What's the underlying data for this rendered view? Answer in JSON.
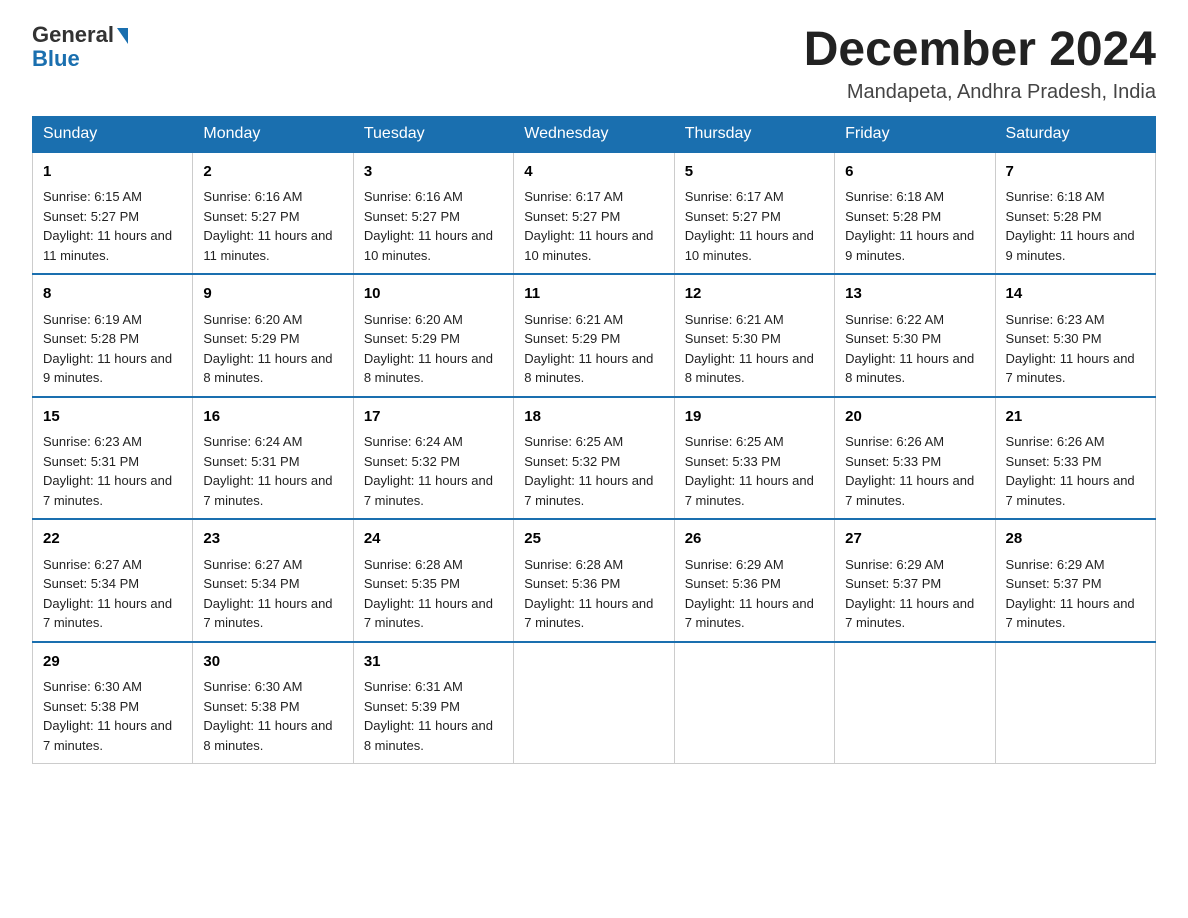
{
  "header": {
    "logo_general": "General",
    "logo_blue": "Blue",
    "title": "December 2024",
    "subtitle": "Mandapeta, Andhra Pradesh, India"
  },
  "columns": [
    "Sunday",
    "Monday",
    "Tuesday",
    "Wednesday",
    "Thursday",
    "Friday",
    "Saturday"
  ],
  "weeks": [
    [
      {
        "day": "1",
        "sunrise": "Sunrise: 6:15 AM",
        "sunset": "Sunset: 5:27 PM",
        "daylight": "Daylight: 11 hours and 11 minutes."
      },
      {
        "day": "2",
        "sunrise": "Sunrise: 6:16 AM",
        "sunset": "Sunset: 5:27 PM",
        "daylight": "Daylight: 11 hours and 11 minutes."
      },
      {
        "day": "3",
        "sunrise": "Sunrise: 6:16 AM",
        "sunset": "Sunset: 5:27 PM",
        "daylight": "Daylight: 11 hours and 10 minutes."
      },
      {
        "day": "4",
        "sunrise": "Sunrise: 6:17 AM",
        "sunset": "Sunset: 5:27 PM",
        "daylight": "Daylight: 11 hours and 10 minutes."
      },
      {
        "day": "5",
        "sunrise": "Sunrise: 6:17 AM",
        "sunset": "Sunset: 5:27 PM",
        "daylight": "Daylight: 11 hours and 10 minutes."
      },
      {
        "day": "6",
        "sunrise": "Sunrise: 6:18 AM",
        "sunset": "Sunset: 5:28 PM",
        "daylight": "Daylight: 11 hours and 9 minutes."
      },
      {
        "day": "7",
        "sunrise": "Sunrise: 6:18 AM",
        "sunset": "Sunset: 5:28 PM",
        "daylight": "Daylight: 11 hours and 9 minutes."
      }
    ],
    [
      {
        "day": "8",
        "sunrise": "Sunrise: 6:19 AM",
        "sunset": "Sunset: 5:28 PM",
        "daylight": "Daylight: 11 hours and 9 minutes."
      },
      {
        "day": "9",
        "sunrise": "Sunrise: 6:20 AM",
        "sunset": "Sunset: 5:29 PM",
        "daylight": "Daylight: 11 hours and 8 minutes."
      },
      {
        "day": "10",
        "sunrise": "Sunrise: 6:20 AM",
        "sunset": "Sunset: 5:29 PM",
        "daylight": "Daylight: 11 hours and 8 minutes."
      },
      {
        "day": "11",
        "sunrise": "Sunrise: 6:21 AM",
        "sunset": "Sunset: 5:29 PM",
        "daylight": "Daylight: 11 hours and 8 minutes."
      },
      {
        "day": "12",
        "sunrise": "Sunrise: 6:21 AM",
        "sunset": "Sunset: 5:30 PM",
        "daylight": "Daylight: 11 hours and 8 minutes."
      },
      {
        "day": "13",
        "sunrise": "Sunrise: 6:22 AM",
        "sunset": "Sunset: 5:30 PM",
        "daylight": "Daylight: 11 hours and 8 minutes."
      },
      {
        "day": "14",
        "sunrise": "Sunrise: 6:23 AM",
        "sunset": "Sunset: 5:30 PM",
        "daylight": "Daylight: 11 hours and 7 minutes."
      }
    ],
    [
      {
        "day": "15",
        "sunrise": "Sunrise: 6:23 AM",
        "sunset": "Sunset: 5:31 PM",
        "daylight": "Daylight: 11 hours and 7 minutes."
      },
      {
        "day": "16",
        "sunrise": "Sunrise: 6:24 AM",
        "sunset": "Sunset: 5:31 PM",
        "daylight": "Daylight: 11 hours and 7 minutes."
      },
      {
        "day": "17",
        "sunrise": "Sunrise: 6:24 AM",
        "sunset": "Sunset: 5:32 PM",
        "daylight": "Daylight: 11 hours and 7 minutes."
      },
      {
        "day": "18",
        "sunrise": "Sunrise: 6:25 AM",
        "sunset": "Sunset: 5:32 PM",
        "daylight": "Daylight: 11 hours and 7 minutes."
      },
      {
        "day": "19",
        "sunrise": "Sunrise: 6:25 AM",
        "sunset": "Sunset: 5:33 PM",
        "daylight": "Daylight: 11 hours and 7 minutes."
      },
      {
        "day": "20",
        "sunrise": "Sunrise: 6:26 AM",
        "sunset": "Sunset: 5:33 PM",
        "daylight": "Daylight: 11 hours and 7 minutes."
      },
      {
        "day": "21",
        "sunrise": "Sunrise: 6:26 AM",
        "sunset": "Sunset: 5:33 PM",
        "daylight": "Daylight: 11 hours and 7 minutes."
      }
    ],
    [
      {
        "day": "22",
        "sunrise": "Sunrise: 6:27 AM",
        "sunset": "Sunset: 5:34 PM",
        "daylight": "Daylight: 11 hours and 7 minutes."
      },
      {
        "day": "23",
        "sunrise": "Sunrise: 6:27 AM",
        "sunset": "Sunset: 5:34 PM",
        "daylight": "Daylight: 11 hours and 7 minutes."
      },
      {
        "day": "24",
        "sunrise": "Sunrise: 6:28 AM",
        "sunset": "Sunset: 5:35 PM",
        "daylight": "Daylight: 11 hours and 7 minutes."
      },
      {
        "day": "25",
        "sunrise": "Sunrise: 6:28 AM",
        "sunset": "Sunset: 5:36 PM",
        "daylight": "Daylight: 11 hours and 7 minutes."
      },
      {
        "day": "26",
        "sunrise": "Sunrise: 6:29 AM",
        "sunset": "Sunset: 5:36 PM",
        "daylight": "Daylight: 11 hours and 7 minutes."
      },
      {
        "day": "27",
        "sunrise": "Sunrise: 6:29 AM",
        "sunset": "Sunset: 5:37 PM",
        "daylight": "Daylight: 11 hours and 7 minutes."
      },
      {
        "day": "28",
        "sunrise": "Sunrise: 6:29 AM",
        "sunset": "Sunset: 5:37 PM",
        "daylight": "Daylight: 11 hours and 7 minutes."
      }
    ],
    [
      {
        "day": "29",
        "sunrise": "Sunrise: 6:30 AM",
        "sunset": "Sunset: 5:38 PM",
        "daylight": "Daylight: 11 hours and 7 minutes."
      },
      {
        "day": "30",
        "sunrise": "Sunrise: 6:30 AM",
        "sunset": "Sunset: 5:38 PM",
        "daylight": "Daylight: 11 hours and 8 minutes."
      },
      {
        "day": "31",
        "sunrise": "Sunrise: 6:31 AM",
        "sunset": "Sunset: 5:39 PM",
        "daylight": "Daylight: 11 hours and 8 minutes."
      },
      null,
      null,
      null,
      null
    ]
  ]
}
